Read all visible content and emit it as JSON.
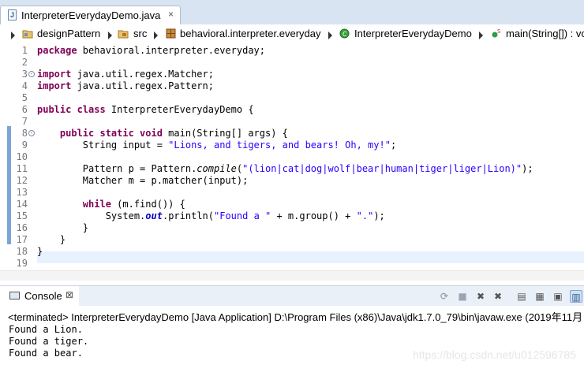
{
  "editor_tab": {
    "title": "InterpreterEverydayDemo.java",
    "close": "×"
  },
  "breadcrumb": [
    "designPattern",
    "src",
    "behavioral.interpreter.everyday",
    "InterpreterEverydayDemo",
    "main(String[]) : vo"
  ],
  "line_numbers": [
    "1",
    "2",
    "3",
    "4",
    "5",
    "6",
    "7",
    "8",
    "9",
    "10",
    "11",
    "12",
    "13",
    "14",
    "15",
    "16",
    "17",
    "18",
    "19"
  ],
  "code": {
    "l1": {
      "kw": "package",
      "rest": " behavioral.interpreter.everyday;"
    },
    "l3": {
      "kw": "import",
      "rest": " java.util.regex.Matcher;"
    },
    "l4": {
      "kw": "import",
      "rest": " java.util.regex.Pattern;"
    },
    "l6": {
      "kw": "public class",
      "rest": " InterpreterEverydayDemo {"
    },
    "l8": {
      "indent": "    ",
      "kw": "public static void",
      "rest": " main(String[] args) {"
    },
    "l9": {
      "indent": "        ",
      "pre": "String input = ",
      "str": "\"Lions, and tigers, and bears! Oh, my!\"",
      "post": ";"
    },
    "l11": {
      "indent": "        ",
      "pre": "Pattern p = Pattern.",
      "call": "compile",
      "open": "(",
      "str": "\"(lion|cat|dog|wolf|bear|human|tiger|liger|Lion)\"",
      "post": ");"
    },
    "l12": {
      "indent": "        ",
      "text": "Matcher m = p.matcher(input);"
    },
    "l14": {
      "indent": "        ",
      "kw": "while",
      "rest": " (m.find()) {"
    },
    "l15": {
      "indent": "            ",
      "pre": "System.",
      "field": "out",
      "mid": ".println(",
      "str1": "\"Found a \"",
      "mid2": " + m.group() + ",
      "str2": "\".\"",
      "post": ");"
    },
    "l16": {
      "indent": "        ",
      "text": "}"
    },
    "l17": {
      "indent": "    ",
      "text": "}"
    },
    "l18": {
      "text": "}"
    }
  },
  "console": {
    "tab_label": "Console",
    "close": "⊠",
    "status": "<terminated> InterpreterEverydayDemo [Java Application] D:\\Program Files (x86)\\Java\\jdk1.7.0_79\\bin\\javaw.exe (2019年11月",
    "output": [
      "Found a Lion.",
      "Found a tiger.",
      "Found a bear."
    ]
  },
  "watermark": "https://blog.csdn.net/u012596785",
  "icons": [
    "java-file-icon",
    "project-icon",
    "package-folder-icon",
    "package-icon",
    "class-icon",
    "method-icon",
    "console-icon"
  ]
}
